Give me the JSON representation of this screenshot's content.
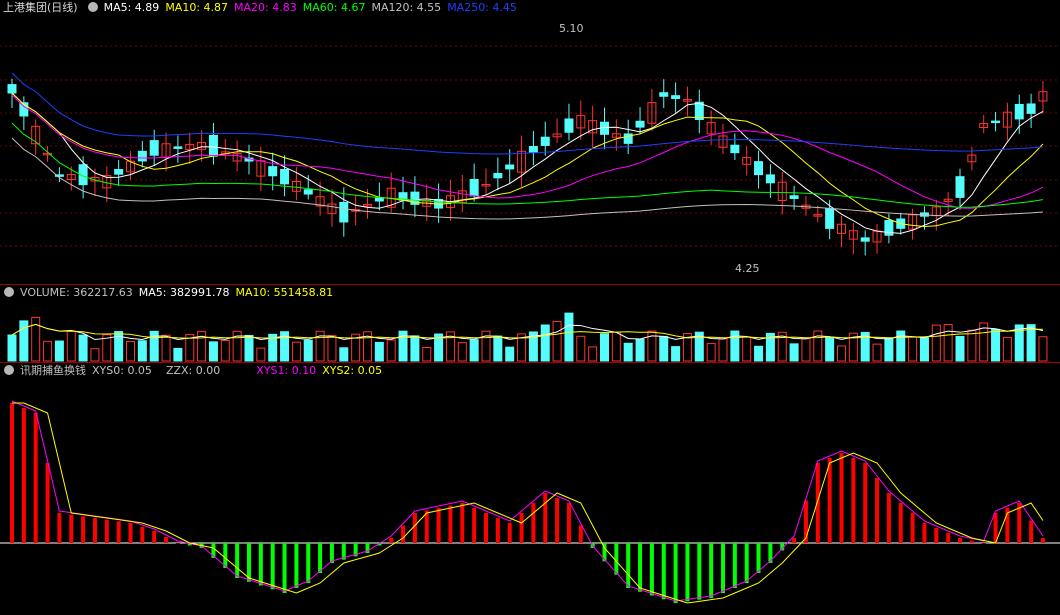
{
  "main_chart": {
    "title": "上港集团(日线)",
    "indicators": [
      {
        "label": "MA5: 4.89",
        "color": "#ffffff"
      },
      {
        "label": "MA10: 4.87",
        "color": "#ffff00"
      },
      {
        "label": "MA20: 4.83",
        "color": "#ff00ff"
      },
      {
        "label": "MA60: 4.67",
        "color": "#00ff00"
      },
      {
        "label": "MA120: 4.55",
        "color": "#c0c0c0"
      },
      {
        "label": "MA250: 4.45",
        "color": "#1f3fff"
      }
    ],
    "high_label": "5.10",
    "low_label": "4.25"
  },
  "volume_chart": {
    "title": "VOLUME: 362217.63",
    "indicators": [
      {
        "label": "MA5: 382991.78",
        "color": "#ffffff"
      },
      {
        "label": "MA10: 551458.81",
        "color": "#ffff00"
      }
    ]
  },
  "indicator_chart": {
    "title": "讯期捕鱼换钱",
    "indicators": [
      {
        "label": "XYS0: 0.05",
        "color": "#c0c0c0"
      },
      {
        "label": "ZZX: 0.00",
        "color": "#c0c0c0"
      },
      {
        "label": "XYS1: 0.10",
        "color": "#ff00ff"
      },
      {
        "label": "XYS2: 0.05",
        "color": "#ffff00"
      }
    ]
  },
  "colors": {
    "up": "#ff3232",
    "down": "#54fcfc",
    "grid": "#7a0000",
    "separator": "#a00000",
    "bar_pos": "#ff0000",
    "bar_neg": "#00ff00"
  }
}
